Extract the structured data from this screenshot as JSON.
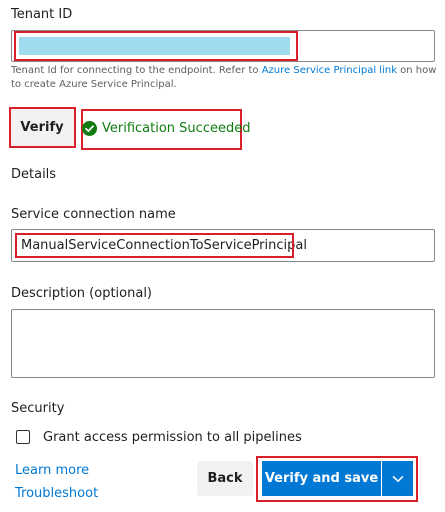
{
  "tenant": {
    "label": "Tenant ID",
    "hint_prefix": "Tenant Id for connecting to the endpoint. Refer to ",
    "hint_link": "Azure Service Principal link",
    "hint_suffix": " on how to create Azure Service Principal."
  },
  "verify": {
    "button_label": "Verify",
    "status_text": "Verification Succeeded",
    "status_color": "#107c10"
  },
  "details": {
    "section_label": "Details",
    "connection_name_label": "Service connection name",
    "connection_name_value": "ManualServiceConnectionToServicePrincipal",
    "description_label": "Description (optional)",
    "description_value": ""
  },
  "security": {
    "section_label": "Security",
    "checkbox_label": "Grant access permission to all pipelines",
    "checked": false
  },
  "footer": {
    "learn_more": "Learn more",
    "troubleshoot": "Troubleshoot",
    "back_label": "Back",
    "save_label": "Verify and save"
  },
  "colors": {
    "accent": "#0078d4",
    "highlight": "#d9202a",
    "redacted": "#9fdcee"
  }
}
